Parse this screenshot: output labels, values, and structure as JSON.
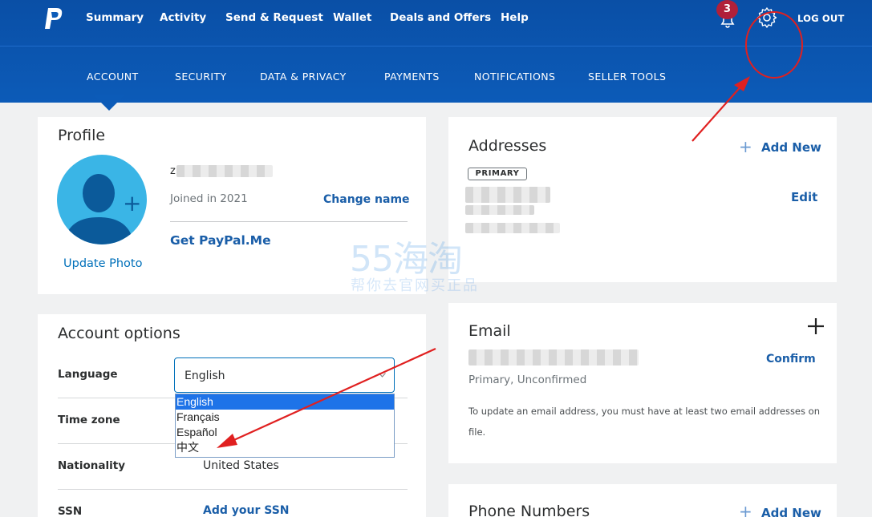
{
  "header": {
    "nav": [
      "Summary",
      "Activity",
      "Send & Request",
      "Wallet",
      "Deals and Offers",
      "Help"
    ],
    "notification_count": "3",
    "logout_label": "LOG OUT",
    "subnav": [
      "ACCOUNT",
      "SECURITY",
      "DATA & PRIVACY",
      "PAYMENTS",
      "NOTIFICATIONS",
      "SELLER TOOLS"
    ],
    "active_subnav": "ACCOUNT"
  },
  "profile": {
    "title": "Profile",
    "name_initial": "z",
    "joined": "Joined in 2021",
    "change_name": "Change name",
    "paypal_me": "Get PayPal.Me",
    "update_photo": "Update Photo"
  },
  "account_options": {
    "title": "Account options",
    "language_label": "Language",
    "language_value": "English",
    "language_options": [
      "English",
      "Français",
      "Español",
      "中文"
    ],
    "timezone_label": "Time zone",
    "nationality_label": "Nationality",
    "nationality_value": "United States",
    "ssn_label": "SSN",
    "ssn_action": "Add your SSN"
  },
  "addresses": {
    "title": "Addresses",
    "add_new": "Add New",
    "primary_badge": "PRIMARY",
    "edit": "Edit"
  },
  "email": {
    "title": "Email",
    "status": "Primary, Unconfirmed",
    "confirm": "Confirm",
    "note": "To update an email address, you must have at least two email addresses on file."
  },
  "phone": {
    "title": "Phone Numbers",
    "add_new": "Add New"
  },
  "watermark": {
    "brand": "55海淘",
    "tagline": "帮你去官网买正品"
  },
  "colors": {
    "header_blue": "#0c5bb8",
    "link_blue": "#0070ba",
    "annotation_red": "#e02020",
    "badge_red": "#b0203a",
    "avatar_blue": "#3ab5e6"
  }
}
